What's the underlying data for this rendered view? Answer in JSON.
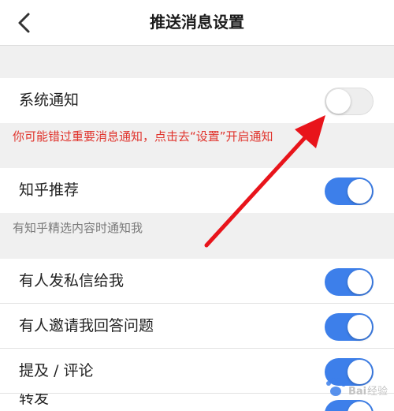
{
  "header": {
    "title": "推送消息设置",
    "back_icon": "chevron-left-icon"
  },
  "settings": {
    "system_notification": {
      "label": "系统通知",
      "enabled": false
    },
    "system_hint": "你可能错过重要消息通知，点击去“设置”开启通知",
    "zhihu_recommend": {
      "label": "知乎推荐",
      "enabled": true
    },
    "recommend_hint": "有知乎精选内容时通知我",
    "private_message": {
      "label": "有人发私信给我",
      "enabled": true
    },
    "invite_answer": {
      "label": "有人邀请我回答问题",
      "enabled": true
    },
    "mention_comment": {
      "label": "提及 / 评论",
      "enabled": true
    },
    "partial_row": {
      "label": "转发"
    }
  },
  "colors": {
    "toggle_on": "#3d7fea",
    "toggle_off": "#eeeeee",
    "hint_red": "#e0332c",
    "annotation_arrow": "#e8141b"
  },
  "watermark": {
    "text": "Baidu经验"
  }
}
